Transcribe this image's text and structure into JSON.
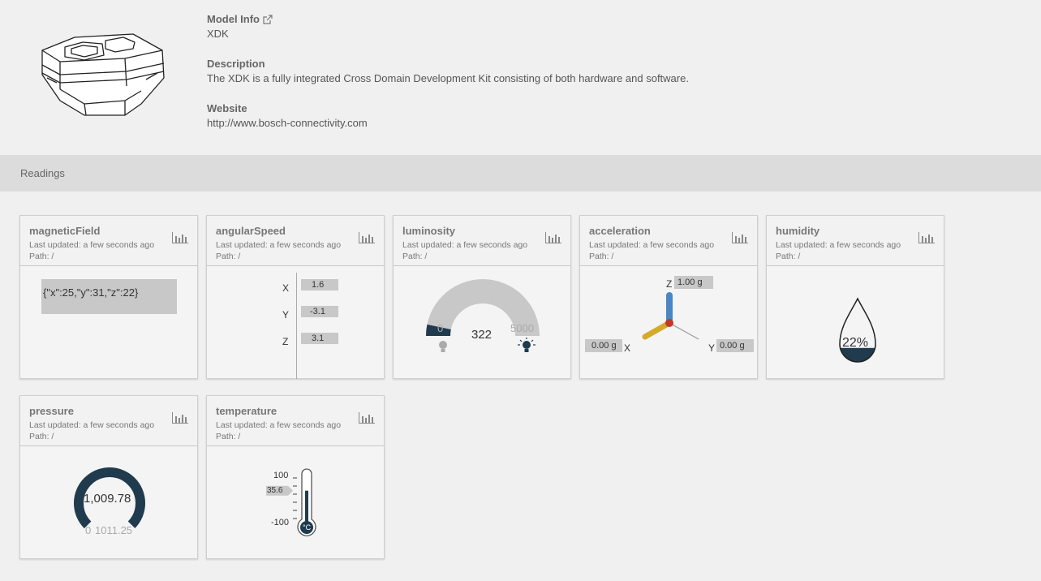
{
  "info": {
    "model_label": "Model Info",
    "model_value": "XDK",
    "description_label": "Description",
    "description_value": "The XDK is a fully integrated Cross Domain Development Kit consisting of both hardware and software.",
    "website_label": "Website",
    "website_value": "http://www.bosch-connectivity.com"
  },
  "readings": {
    "title": "Readings"
  },
  "colors": {
    "dark": "#1f3b4d",
    "gray": "#c8c8c8",
    "blue": "#4a86c5",
    "yellow": "#d4aa2a",
    "red": "#c0392b"
  },
  "cards": {
    "magneticField": {
      "title": "magneticField",
      "updated": "Last updated: a few seconds ago",
      "path": "Path: /",
      "value": "{\"x\":25,\"y\":31,\"z\":22}"
    },
    "angularSpeed": {
      "title": "angularSpeed",
      "updated": "Last updated: a few seconds ago",
      "path": "Path: /",
      "x_label": "X",
      "y_label": "Y",
      "z_label": "Z",
      "x": "1.6",
      "y": "-3.1",
      "z": "3.1"
    },
    "luminosity": {
      "title": "luminosity",
      "updated": "Last updated: a few seconds ago",
      "path": "Path: /",
      "value": "322",
      "min": "0",
      "max": "5000",
      "fraction": 0.0644
    },
    "acceleration": {
      "title": "acceleration",
      "updated": "Last updated: a few seconds ago",
      "path": "Path: /",
      "z_label": "Z",
      "z": "1.00 g",
      "x_label": "X",
      "x": "0.00 g",
      "y_label": "Y",
      "y": "0.00 g"
    },
    "humidity": {
      "title": "humidity",
      "updated": "Last updated: a few seconds ago",
      "path": "Path: /",
      "value": "22%",
      "fraction": 0.22
    },
    "pressure": {
      "title": "pressure",
      "updated": "Last updated: a few seconds ago",
      "path": "Path: /",
      "value": "1,009.78",
      "min": "0",
      "max": "1011.25",
      "fraction": 0.9985
    },
    "temperature": {
      "title": "temperature",
      "updated": "Last updated: a few seconds ago",
      "path": "Path: /",
      "max": "100",
      "min": "-100",
      "value": "35.6",
      "unit": "°C",
      "fraction": 0.678
    }
  }
}
